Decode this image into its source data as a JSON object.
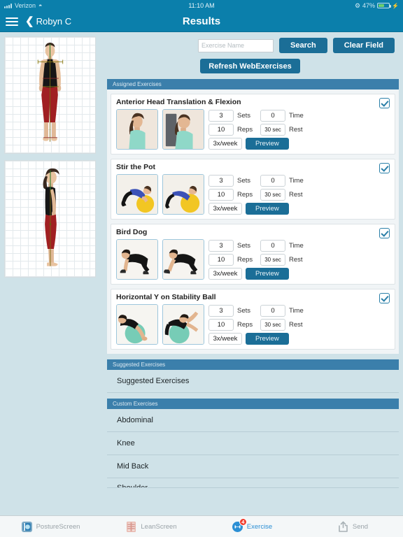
{
  "statusbar": {
    "carrier": "Verizon",
    "time": "11:10 AM",
    "battery_pct": "47%",
    "wifi_icon": "wifi-icon",
    "bluetooth_icon": "bluetooth-icon",
    "charging_icon": "charging-plug-icon"
  },
  "navbar": {
    "menu_icon": "hamburger-menu-icon",
    "back_icon": "chevron-left-icon",
    "back_label": "Robyn C",
    "title": "Results"
  },
  "sidebar": {
    "posture_images": [
      {
        "name": "posture-photo-front",
        "view": "front"
      },
      {
        "name": "posture-photo-side",
        "view": "side"
      }
    ]
  },
  "search": {
    "placeholder": "Exercise Name",
    "value": "",
    "search_label": "Search",
    "clear_label": "Clear Field"
  },
  "refresh": {
    "label": "Refresh WebExercises"
  },
  "sections": {
    "assigned_header": "Assigned Exercises",
    "suggested_header": "Suggested Exercises",
    "custom_header": "Custom Exercises"
  },
  "assigned_exercises": [
    {
      "title": "Anterior Head Translation & Flexion",
      "sets": "3",
      "sets_label": "Sets",
      "time": "0",
      "time_label": "Time",
      "reps": "10",
      "reps_label": "Reps",
      "rest": "30 sec",
      "rest_label": "Rest",
      "frequency": "3x/week",
      "preview_label": "Preview",
      "checked": true
    },
    {
      "title": "Stir the Pot",
      "sets": "3",
      "sets_label": "Sets",
      "time": "0",
      "time_label": "Time",
      "reps": "10",
      "reps_label": "Reps",
      "rest": "30 sec",
      "rest_label": "Rest",
      "frequency": "3x/week",
      "preview_label": "Preview",
      "checked": true
    },
    {
      "title": "Bird Dog",
      "sets": "3",
      "sets_label": "Sets",
      "time": "0",
      "time_label": "Time",
      "reps": "10",
      "reps_label": "Reps",
      "rest": "30 sec",
      "rest_label": "Rest",
      "frequency": "3x/week",
      "preview_label": "Preview",
      "checked": true
    },
    {
      "title": "Horizontal Y on Stability Ball",
      "sets": "3",
      "sets_label": "Sets",
      "time": "0",
      "time_label": "Time",
      "reps": "10",
      "reps_label": "Reps",
      "rest": "30 sec",
      "rest_label": "Rest",
      "frequency": "3x/week",
      "preview_label": "Preview",
      "checked": true
    }
  ],
  "suggested_list": [
    {
      "label": "Suggested Exercises"
    }
  ],
  "custom_list": [
    {
      "label": "Abdominal"
    },
    {
      "label": "Knee"
    },
    {
      "label": "Mid Back"
    },
    {
      "label": "Shoulder"
    }
  ],
  "tabbar": {
    "tabs": [
      {
        "label": "PostureScreen",
        "icon": "posturescreen-app-icon",
        "active": false,
        "badge": ""
      },
      {
        "label": "LeanScreen",
        "icon": "leanscreen-app-icon",
        "active": false,
        "badge": ""
      },
      {
        "label": "Exercise",
        "icon": "exercise-app-icon",
        "active": true,
        "badge": "4"
      },
      {
        "label": "Send",
        "icon": "share-arrow-icon",
        "active": false,
        "badge": ""
      }
    ]
  },
  "colors": {
    "nav_blue": "#0b7fab",
    "section_blue": "#3b7fab",
    "button_blue": "#1b6e97",
    "page_bg": "#cfe2e8",
    "badge_red": "#f03c2e",
    "active_tab": "#2b8fd4"
  }
}
